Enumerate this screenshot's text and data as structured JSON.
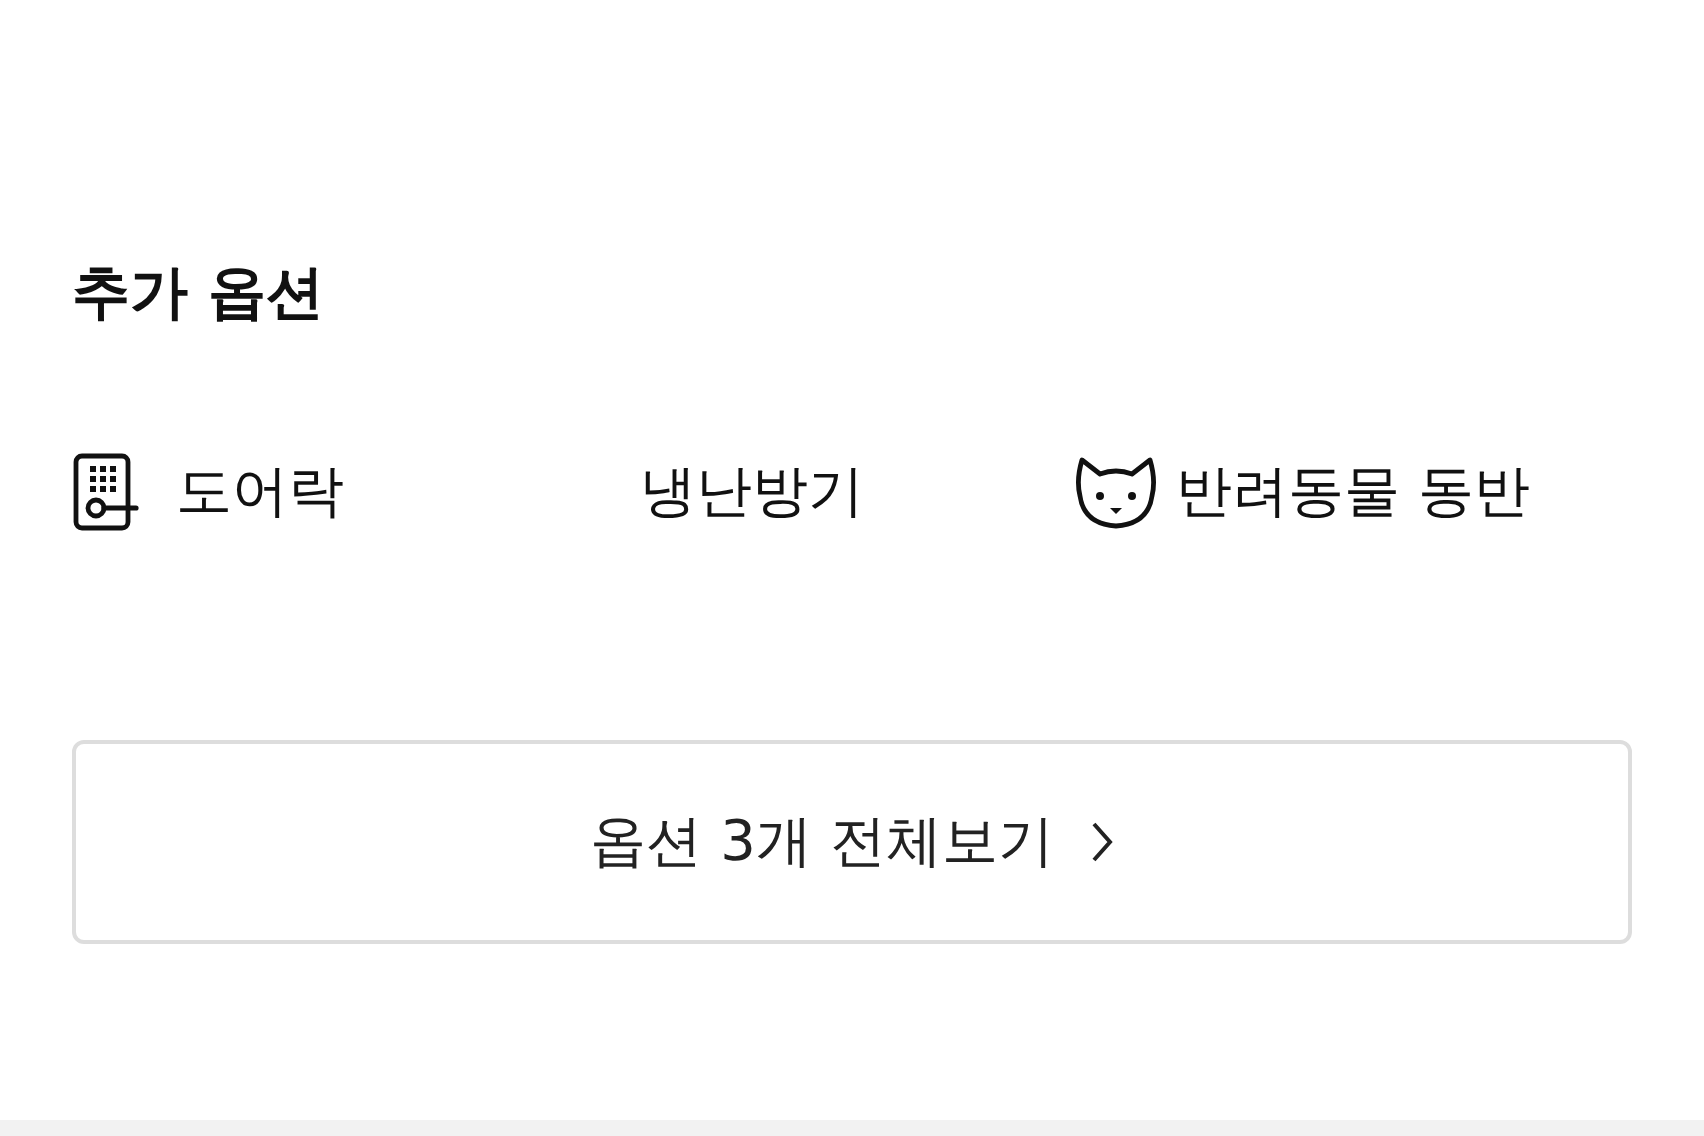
{
  "section": {
    "title": "추가 옵션"
  },
  "options": [
    {
      "label": "도어락",
      "kind": "doorlock"
    },
    {
      "label": "냉난방기",
      "kind": "plain"
    },
    {
      "label": "반려동물 동반",
      "kind": "pet"
    }
  ],
  "more_button": {
    "label": "옵션 3개 전체보기"
  }
}
